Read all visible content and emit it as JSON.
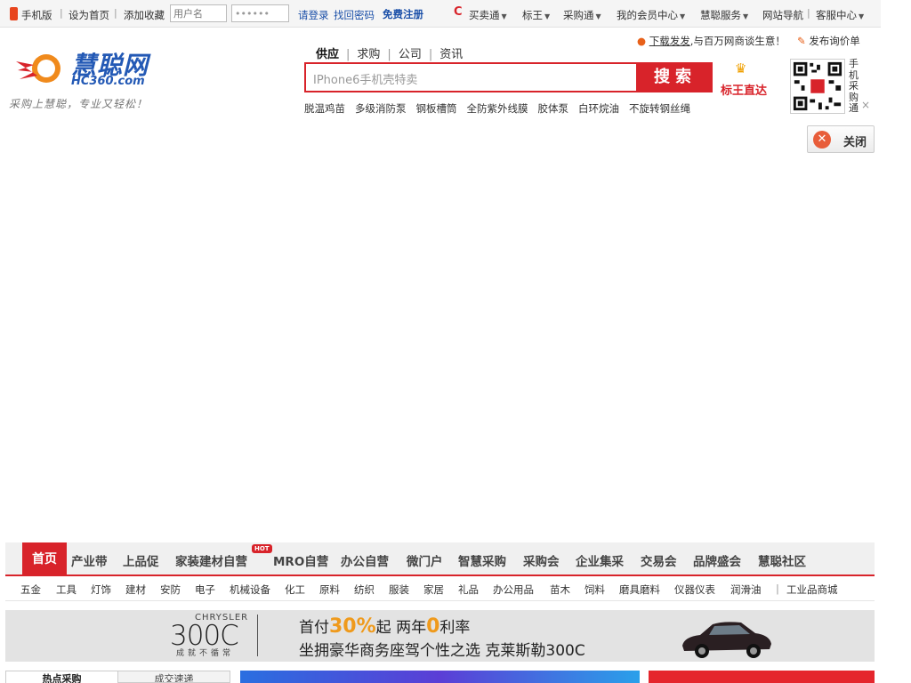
{
  "topbar": {
    "mobile": "手机版",
    "set_home": "设为首页",
    "favorite": "添加收藏",
    "username_placeholder": "用户名",
    "password_value": "••••••",
    "login": "请登录",
    "find_password": "找回密码",
    "register": "免费注册",
    "menus": [
      "买卖通",
      "标王",
      "采购通",
      "我的会员中心",
      "慧聪服务"
    ],
    "site_nav": "网站导航",
    "customer_service": "客服中心"
  },
  "header": {
    "logo_name": "慧聪网",
    "logo_domain": "HC360.com",
    "slogan": "采购上慧聪，专业又轻松！",
    "search_tabs": [
      "供应",
      "求购",
      "公司",
      "资讯"
    ],
    "search_placeholder": "IPhone6手机壳特卖",
    "search_button": "搜索",
    "hot_words": [
      "脱温鸡苗",
      "多级消防泵",
      "钢板槽筒",
      "全防紫外线膜",
      "胶体泵",
      "白环烷油",
      "不旋转钢丝绳"
    ],
    "biaowang": "标王直达",
    "promo_download": "下载发发",
    "promo_text": ",与百万网商谈生意！",
    "publish": "发布询价单",
    "qr_label": "手机采购通",
    "qr_close": "×",
    "close_button": "关闭"
  },
  "main_nav": {
    "items": [
      "首页",
      "产业带",
      "上品促",
      "家装建材自营",
      "MRO自营",
      "办公自营",
      "微门户",
      "智慧采购",
      "采购会",
      "企业集采",
      "交易会",
      "品牌盛会",
      "慧聪社区"
    ],
    "hot_badge": "HOT"
  },
  "sub_nav": {
    "items": [
      "五金",
      "工具",
      "灯饰",
      "建材",
      "安防",
      "电子",
      "机械设备",
      "化工",
      "原料",
      "纺织",
      "服装",
      "家居",
      "礼品",
      "办公用品",
      "苗木",
      "饲料",
      "磨具磨料",
      "仪器仪表",
      "润滑油"
    ],
    "industry_mall": "工业品商城"
  },
  "banner": {
    "brand": "CHRYSLER",
    "model": "300C",
    "tagline": "成就不循常",
    "line1_a": "首付",
    "line1_b": "30%",
    "line1_c": "起  两年",
    "line1_d": "0",
    "line1_e": "利率",
    "line2": "坐拥豪华商务座驾个性之选  克莱斯勒300C"
  },
  "bottom": {
    "tab_hot": "热点采购",
    "tab_deal": "成交速递"
  },
  "colors": {
    "brand_red": "#d8232a",
    "brand_blue": "#2359b5",
    "link_blue": "#1a4fa8",
    "banner_orange": "#ef9a1c"
  }
}
